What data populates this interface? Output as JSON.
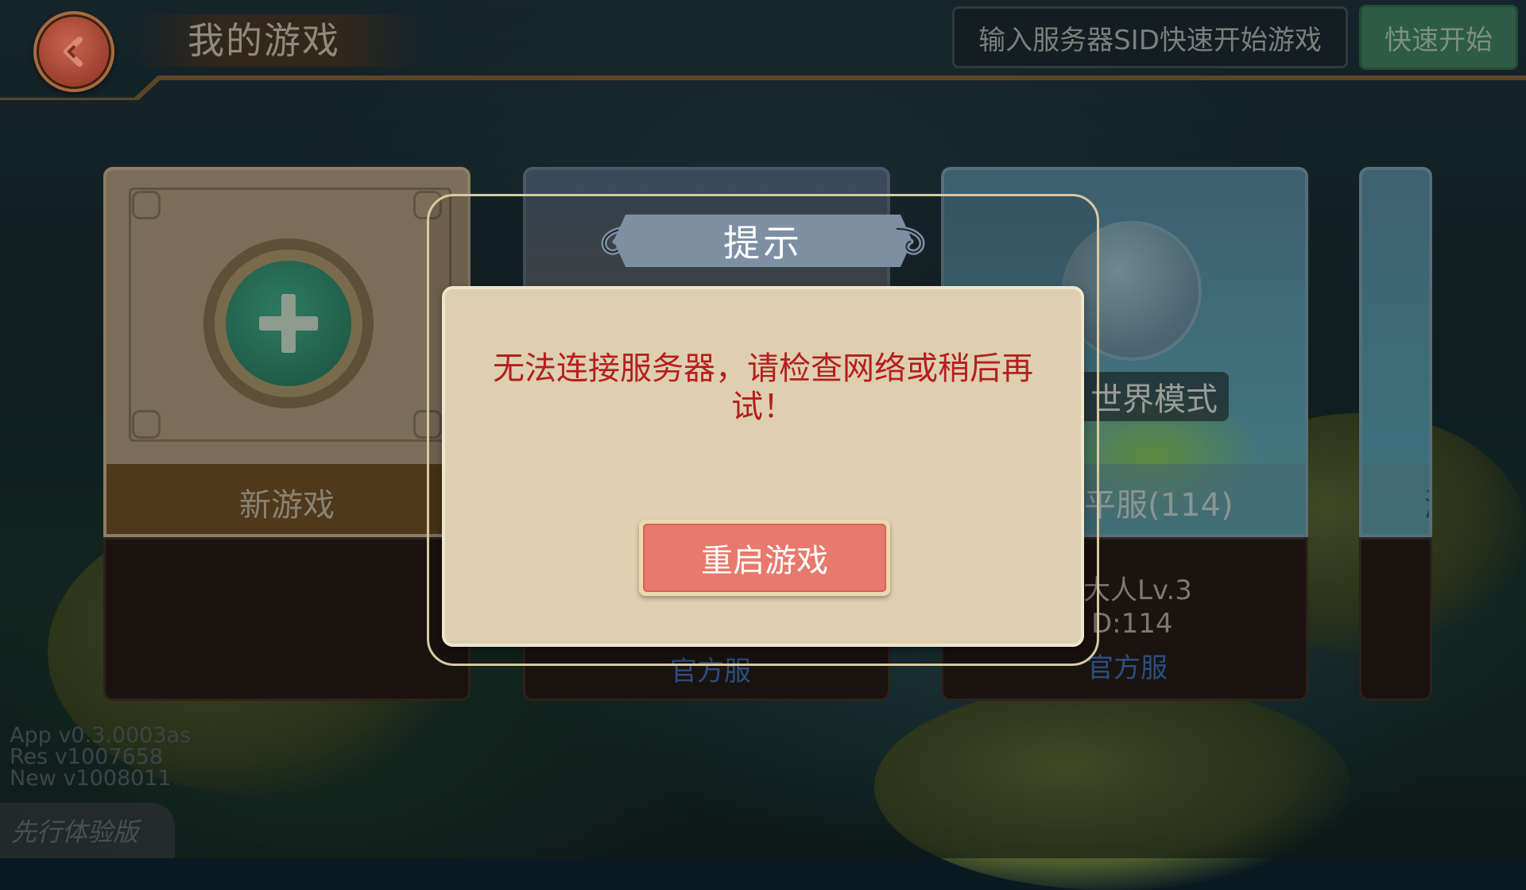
{
  "header": {
    "title": "我的游戏",
    "sid_input_placeholder": "输入服务器SID快速开始游戏",
    "quick_start_label": "快速开始"
  },
  "cards": {
    "new_game": {
      "label": "新游戏"
    },
    "card2": {
      "official": "官方服"
    },
    "card3": {
      "mode": "世界模式",
      "server": "平服(114)",
      "player": "大人Lv.3",
      "id": "D:114",
      "official": "官方服"
    },
    "card4": {
      "server": "游"
    }
  },
  "version": {
    "app": "App  v0.3.0003as",
    "res": "Res   v1007658",
    "new": "New v1008011"
  },
  "beta_tag": "先行体验版",
  "dialog": {
    "title": "提示",
    "message_line1": "无法连接服务器，请检查网络或稍后再",
    "message_line2": "试！",
    "button_label": "重启游戏"
  },
  "colors": {
    "dialog_message": "#b61e1e",
    "restart_button": "#e77a6c",
    "dialog_panel": "#ddcfb0",
    "banner": "#7d8fa3"
  }
}
